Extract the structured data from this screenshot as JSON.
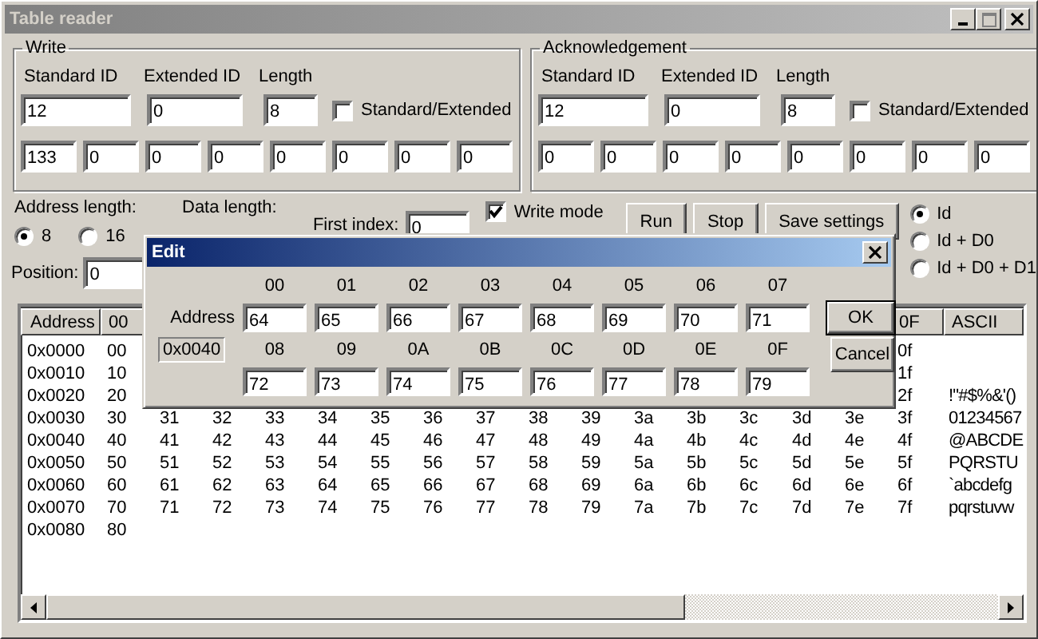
{
  "window": {
    "title": "Table reader"
  },
  "write": {
    "title": "Write",
    "standard_id_label": "Standard ID",
    "extended_id_label": "Extended ID",
    "length_label": "Length",
    "standard_id": "12",
    "extended_id": "0",
    "length": "8",
    "standard_extended": {
      "label": "Standard/Extended",
      "checked": false
    },
    "data": [
      "133",
      "0",
      "0",
      "0",
      "0",
      "0",
      "0",
      "0"
    ]
  },
  "acknowledgement": {
    "title": "Acknowledgement",
    "standard_id_label": "Standard ID",
    "extended_id_label": "Extended ID",
    "length_label": "Length",
    "standard_id": "12",
    "extended_id": "0",
    "length": "8",
    "standard_extended": {
      "label": "Standard/Extended",
      "checked": false
    },
    "data": [
      "0",
      "0",
      "0",
      "0",
      "0",
      "0",
      "0",
      "0"
    ]
  },
  "address_length": {
    "label": "Address length:",
    "options": [
      {
        "label": "8",
        "selected": true
      },
      {
        "label": "16",
        "selected": false
      }
    ]
  },
  "data_length": {
    "label": "Data length:"
  },
  "first_index": {
    "label": "First index:",
    "value": "0"
  },
  "write_mode": {
    "label": "Write mode",
    "checked": true
  },
  "buttons": [
    "Run",
    "Stop",
    "Save settings"
  ],
  "id_mode": [
    {
      "label": "Id",
      "selected": true
    },
    {
      "label": "Id + D0",
      "selected": false
    },
    {
      "label": "Id + D0 + D1",
      "selected": false
    }
  ],
  "position": {
    "label": "Position:",
    "value": "0"
  },
  "table": {
    "address_header": "Address",
    "value_headers": {
      "00": "00",
      "0F": "0F"
    },
    "ascii_header": "ASCII",
    "rows": [
      {
        "address": "0x0000",
        "values": {
          "00": "00",
          "0F": "0f"
        }
      },
      {
        "address": "0x0010",
        "values": {
          "00": "10",
          "0F": "1f"
        }
      },
      {
        "address": "0x0020",
        "values": {
          "00": "20",
          "0F": "2f"
        },
        "ascii": "!\"#$%&'()"
      },
      {
        "address": "0x0030",
        "values": {
          "00": "30",
          "01": "31",
          "02": "32",
          "03": "33",
          "04": "34",
          "05": "35",
          "06": "36",
          "07": "37",
          "08": "38",
          "09": "39",
          "0A": "3a",
          "0B": "3b",
          "0C": "3c",
          "0D": "3d",
          "0E": "3e",
          "0F": "3f"
        },
        "ascii": "01234567"
      },
      {
        "address": "0x0040",
        "values": {
          "00": "40",
          "01": "41",
          "02": "42",
          "03": "43",
          "04": "44",
          "05": "45",
          "06": "46",
          "07": "47",
          "08": "48",
          "09": "49",
          "0A": "4a",
          "0B": "4b",
          "0C": "4c",
          "0D": "4d",
          "0E": "4e",
          "0F": "4f"
        },
        "ascii": "@ABCDE"
      },
      {
        "address": "0x0050",
        "values": {
          "00": "50",
          "01": "51",
          "02": "52",
          "03": "53",
          "04": "54",
          "05": "55",
          "06": "56",
          "07": "57",
          "08": "58",
          "09": "59",
          "0A": "5a",
          "0B": "5b",
          "0C": "5c",
          "0D": "5d",
          "0E": "5e",
          "0F": "5f"
        },
        "ascii": "PQRSTU"
      },
      {
        "address": "0x0060",
        "values": {
          "00": "60",
          "01": "61",
          "02": "62",
          "03": "63",
          "04": "64",
          "05": "65",
          "06": "66",
          "07": "67",
          "08": "68",
          "09": "69",
          "0A": "6a",
          "0B": "6b",
          "0C": "6c",
          "0D": "6d",
          "0E": "6e",
          "0F": "6f"
        },
        "ascii": "`abcdefg"
      },
      {
        "address": "0x0070",
        "values": {
          "00": "70",
          "01": "71",
          "02": "72",
          "03": "73",
          "04": "74",
          "05": "75",
          "06": "76",
          "07": "77",
          "08": "78",
          "09": "79",
          "0A": "7a",
          "0B": "7b",
          "0C": "7c",
          "0D": "7d",
          "0E": "7e",
          "0F": "7f"
        },
        "ascii": "pqrstuvw"
      },
      {
        "address": "0x0080",
        "values": {
          "00": "80"
        }
      }
    ]
  },
  "edit_dialog": {
    "title": "Edit",
    "address_label": "Address",
    "address": "0x0040",
    "columns": [
      "00",
      "01",
      "02",
      "03",
      "04",
      "05",
      "06",
      "07",
      "08",
      "09",
      "0A",
      "0B",
      "0C",
      "0D",
      "0E",
      "0F"
    ],
    "values": [
      "64",
      "65",
      "66",
      "67",
      "68",
      "69",
      "70",
      "71",
      "72",
      "73",
      "74",
      "75",
      "76",
      "77",
      "78",
      "79"
    ],
    "buttons": [
      "OK",
      "Cancel"
    ]
  }
}
